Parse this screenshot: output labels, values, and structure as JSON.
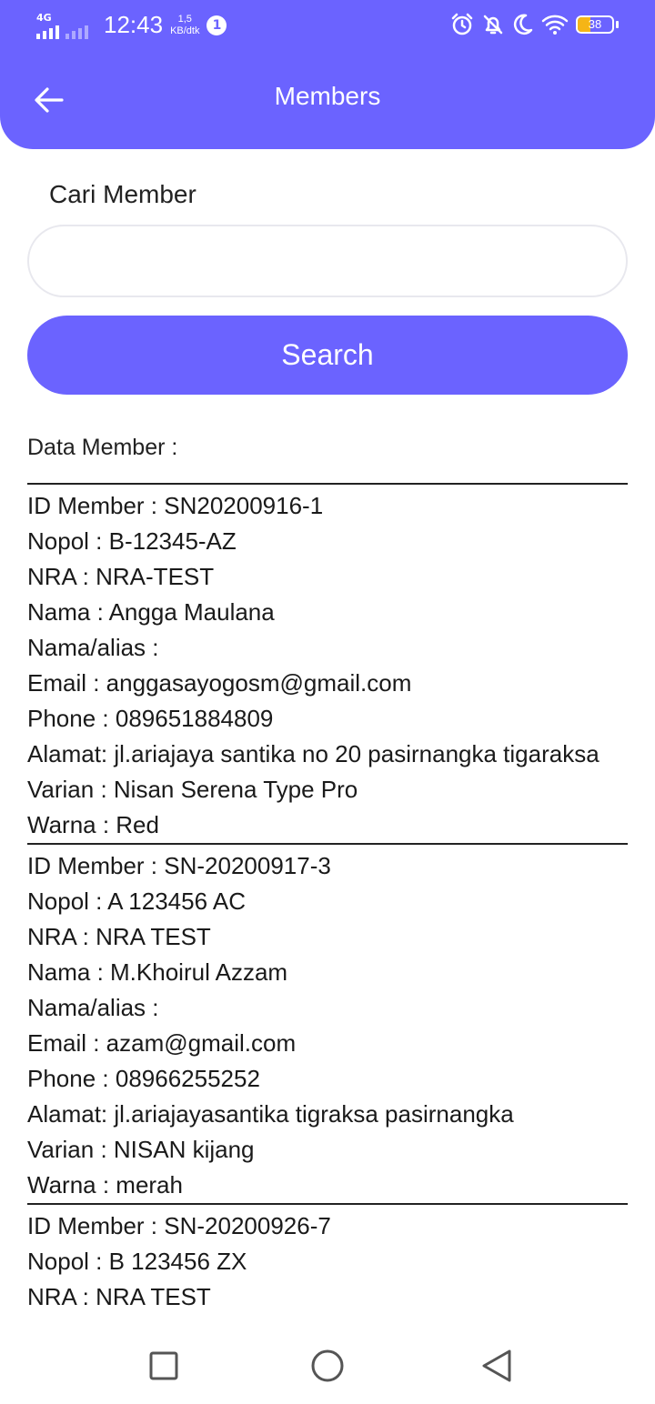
{
  "status_bar": {
    "network": "4G",
    "time": "12:43",
    "speed_value": "1,5",
    "speed_unit": "KB/dtk",
    "notification_count": "1",
    "battery_level": "38",
    "icons": [
      "alarm-icon",
      "bell-off-icon",
      "moon-icon",
      "wifi-icon",
      "battery-icon"
    ]
  },
  "app_bar": {
    "title": "Members",
    "back_icon": "arrow-left-icon",
    "color": "#6b63ff"
  },
  "search": {
    "label": "Cari Member",
    "input_value": "",
    "placeholder": "",
    "button_label": "Search"
  },
  "data_label": "Data Member :",
  "members": [
    {
      "lines": [
        "ID Member : SN20200916-1",
        "Nopol : B-12345-AZ",
        "NRA : NRA-TEST",
        "Nama  : Angga Maulana",
        "Nama/alias :",
        "Email : anggasayogosm@gmail.com",
        "Phone : 089651884809",
        "Alamat: jl.ariajaya santika no 20 pasirnangka tigaraksa",
        "Varian : Nisan Serena Type Pro",
        "Warna : Red"
      ]
    },
    {
      "lines": [
        "ID Member : SN-20200917-3",
        "Nopol : A 123456 AC",
        "NRA : NRA TEST",
        "Nama  : M.Khoirul Azzam",
        "Nama/alias :",
        "Email : azam@gmail.com",
        "Phone : 08966255252",
        "Alamat: jl.ariajayasantika tigraksa pasirnangka",
        "Varian : NISAN kijang",
        "Warna : merah"
      ]
    },
    {
      "lines": [
        "ID Member : SN-20200926-7",
        "Nopol : B 123456 ZX",
        "NRA : NRA TEST"
      ]
    }
  ],
  "nav_bar": {
    "icons": [
      "recent-apps-icon",
      "home-icon",
      "back-icon"
    ]
  }
}
